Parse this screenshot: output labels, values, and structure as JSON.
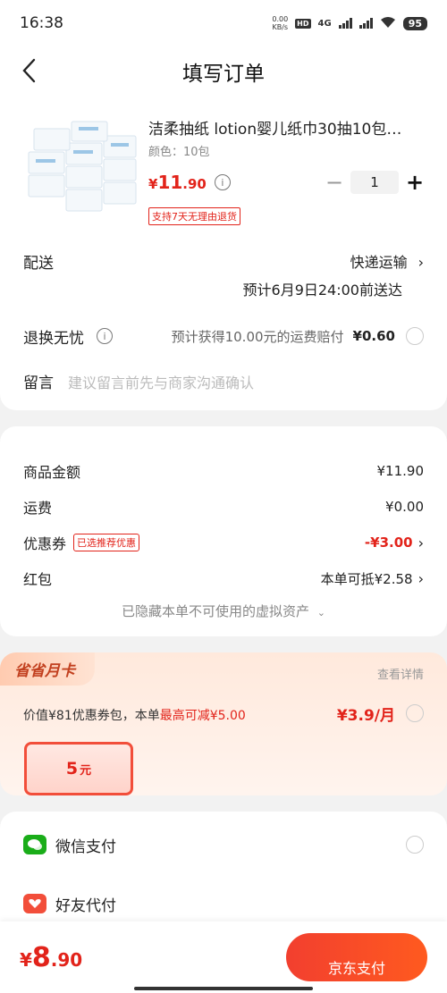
{
  "status_bar": {
    "time": "16:38",
    "net_speed_top": "0.00",
    "net_speed_bottom": "KB/s",
    "hd_label": "HD",
    "net_type": "4G",
    "battery": "95"
  },
  "header": {
    "title": "填写订单"
  },
  "product": {
    "name": "洁柔抽纸 lotion婴儿纸巾30抽10包…",
    "spec": "颜色：10包",
    "price_symbol": "¥",
    "price_int": "11",
    "price_dec": ".90",
    "quantity": "1",
    "minus_label": "−",
    "plus_label": "+",
    "return_badge": "支持7天无理由退货"
  },
  "shipping": {
    "label": "配送",
    "method": "快递运输",
    "eta": "预计6月9日24:00前送达"
  },
  "returns_insurance": {
    "label": "退换无忧",
    "note": "预计获得10.00元的运费赔付",
    "fee": "¥0.60"
  },
  "message": {
    "label": "留言",
    "placeholder": "建议留言前先与商家沟通确认"
  },
  "summary": {
    "goods_label": "商品金额",
    "goods_value": "¥11.90",
    "freight_label": "运费",
    "freight_value": "¥0.00",
    "coupon_label": "优惠券",
    "coupon_tag": "已选推荐优惠",
    "coupon_value": "-¥3.00",
    "redpacket_label": "红包",
    "redpacket_value": "本单可抵¥2.58",
    "hidden_assets": "已隐藏本单不可使用的虚拟资产"
  },
  "monthly_card": {
    "title": "省省月卡",
    "detail_link": "查看详情",
    "desc_prefix": "价值¥81优惠券包，本单",
    "desc_highlight": "最高可减¥5.00",
    "price": "¥3.9/月",
    "coupon_amount": "5",
    "coupon_unit": "元"
  },
  "payment": {
    "wechat_label": "微信支付",
    "friend_label": "好友代付"
  },
  "bottom_bar": {
    "price_symbol": "¥",
    "price_int": "8",
    "price_dec": ".90",
    "pay_button": "京东支付"
  },
  "colors": {
    "accent_red": "#e2231a",
    "wechat_green": "#1aad19",
    "background": "#f2f2f2"
  }
}
